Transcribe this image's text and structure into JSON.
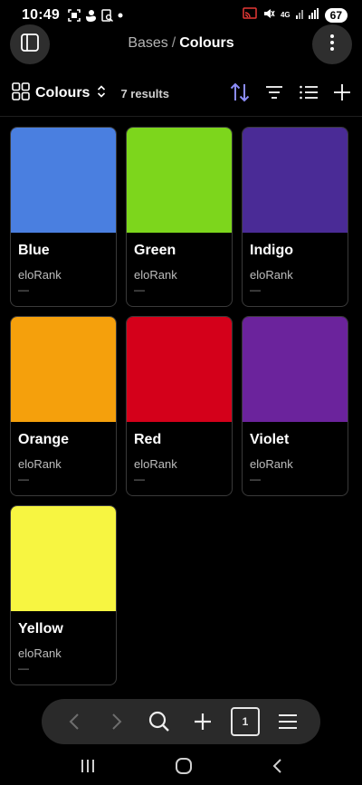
{
  "status_bar": {
    "time": "10:49",
    "battery": "67",
    "network_label": "4G",
    "icons": [
      "screenshot-icon",
      "duck-icon",
      "screen-search-icon",
      "notification-dot-icon",
      "cast-icon",
      "mute-icon",
      "signal-icon"
    ]
  },
  "header": {
    "breadcrumb_parent": "Bases",
    "breadcrumb_separator": "/",
    "breadcrumb_current": "Colours"
  },
  "toolbar": {
    "view_name": "Colours",
    "results": "7 results",
    "accent_color": "#8b8cf7"
  },
  "cards": [
    {
      "title": "Blue",
      "property": "eloRank",
      "value": "—",
      "color": "#4a7fe0"
    },
    {
      "title": "Green",
      "property": "eloRank",
      "value": "—",
      "color": "#7dd61c"
    },
    {
      "title": "Indigo",
      "property": "eloRank",
      "value": "—",
      "color": "#4a2b96"
    },
    {
      "title": "Orange",
      "property": "eloRank",
      "value": "—",
      "color": "#f5a00c"
    },
    {
      "title": "Red",
      "property": "eloRank",
      "value": "—",
      "color": "#d4001a"
    },
    {
      "title": "Violet",
      "property": "eloRank",
      "value": "—",
      "color": "#6b239c"
    },
    {
      "title": "Yellow",
      "property": "eloRank",
      "value": "—",
      "color": "#f7f541"
    }
  ],
  "browser_bar": {
    "tab_count": "1"
  }
}
